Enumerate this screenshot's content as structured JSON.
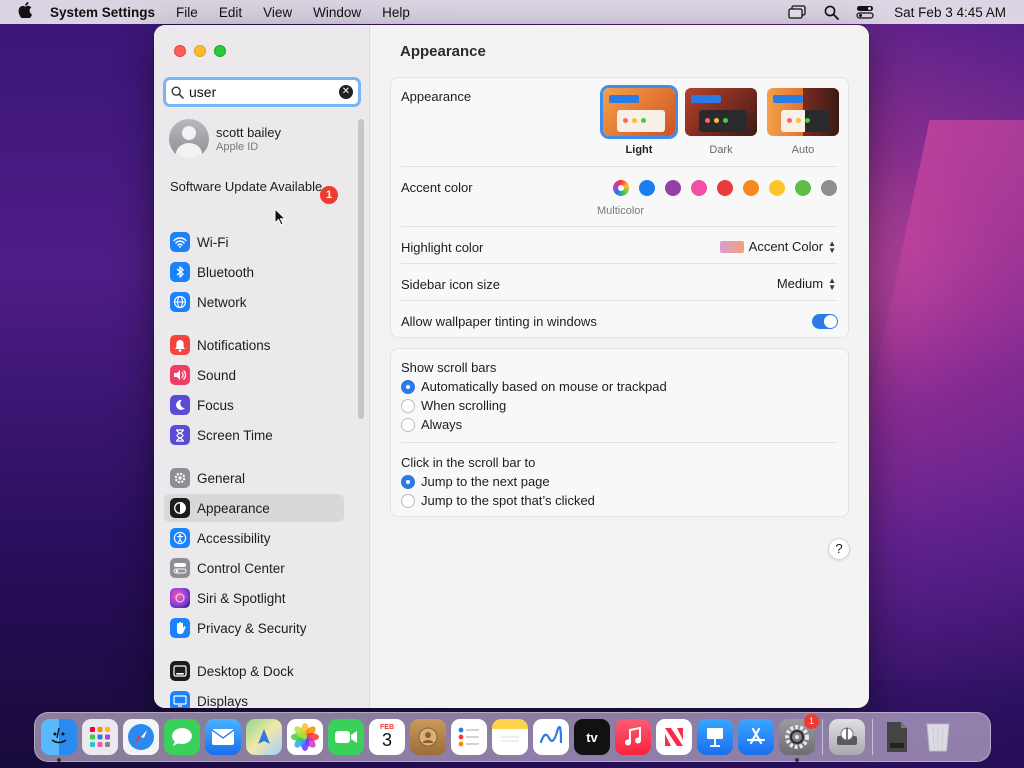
{
  "menubar": {
    "app_name": "System Settings",
    "menus": [
      "File",
      "Edit",
      "View",
      "Window",
      "Help"
    ],
    "clock": "Sat Feb 3  4:45 AM"
  },
  "sidebar": {
    "search": {
      "value": "user",
      "placeholder": "Search"
    },
    "profile": {
      "name": "scott bailey",
      "subtitle": "Apple ID"
    },
    "update": {
      "label": "Software Update Available",
      "badge": "1"
    },
    "items": [
      {
        "label": "Wi-Fi",
        "icon": "wifi-icon",
        "color": "#1a82fb"
      },
      {
        "label": "Bluetooth",
        "icon": "bluetooth-icon",
        "color": "#1a82fb"
      },
      {
        "label": "Network",
        "icon": "globe-icon",
        "color": "#1a82fb"
      },
      {
        "label": "Notifications",
        "icon": "bell-icon",
        "color": "#f1453d"
      },
      {
        "label": "Sound",
        "icon": "speaker-icon",
        "color": "#ef3e63"
      },
      {
        "label": "Focus",
        "icon": "moon-icon",
        "color": "#5b4bd6"
      },
      {
        "label": "Screen Time",
        "icon": "hourglass-icon",
        "color": "#5b4bd6"
      },
      {
        "label": "General",
        "icon": "gear-icon",
        "color": "#8e8e93"
      },
      {
        "label": "Appearance",
        "icon": "appearance-icon",
        "color": "#1c1c1e"
      },
      {
        "label": "Accessibility",
        "icon": "accessibility-icon",
        "color": "#1a82fb"
      },
      {
        "label": "Control Center",
        "icon": "control-center-icon",
        "color": "#8e8e93"
      },
      {
        "label": "Siri & Spotlight",
        "icon": "siri-icon",
        "color": "#a848d8"
      },
      {
        "label": "Privacy & Security",
        "icon": "hand-icon",
        "color": "#1a82fb"
      },
      {
        "label": "Desktop & Dock",
        "icon": "desktop-icon",
        "color": "#1c1c1e"
      },
      {
        "label": "Displays",
        "icon": "display-icon",
        "color": "#1a82fb"
      }
    ]
  },
  "main": {
    "title": "Appearance",
    "appearance": {
      "label": "Appearance",
      "options": [
        "Light",
        "Dark",
        "Auto"
      ],
      "selected": "Light"
    },
    "accent": {
      "label": "Accent color",
      "selected_label": "Multicolor",
      "colors": [
        "#1b7cf0",
        "#9341a8",
        "#f34fa4",
        "#e83b3b",
        "#f48a1d",
        "#fcc62a",
        "#5ebe45",
        "#8e8e8e"
      ]
    },
    "highlight": {
      "label": "Highlight color",
      "value": "Accent Color"
    },
    "sidebar_icon_size": {
      "label": "Sidebar icon size",
      "value": "Medium"
    },
    "wallpaper_tinting": {
      "label": "Allow wallpaper tinting in windows",
      "on": true
    },
    "scroll_bars": {
      "label": "Show scroll bars",
      "options": [
        "Automatically based on mouse or trackpad",
        "When scrolling",
        "Always"
      ]
    },
    "click_scroll": {
      "label": "Click in the scroll bar to",
      "options": [
        "Jump to the next page",
        "Jump to the spot that’s clicked"
      ]
    },
    "help": "?"
  },
  "dock": {
    "apps": [
      "Finder",
      "Launchpad",
      "Safari",
      "Messages",
      "Mail",
      "Maps",
      "Photos",
      "FaceTime",
      "Calendar",
      "Contacts",
      "Reminders",
      "Notes",
      "Freeform",
      "TV",
      "Music",
      "News",
      "Keynote",
      "App Store",
      "System Settings",
      "Disk Utility",
      "Document",
      "Trash"
    ],
    "calendar_month": "FEB",
    "calendar_day": "3",
    "tv_label": "tv",
    "settings_badge": "1"
  }
}
